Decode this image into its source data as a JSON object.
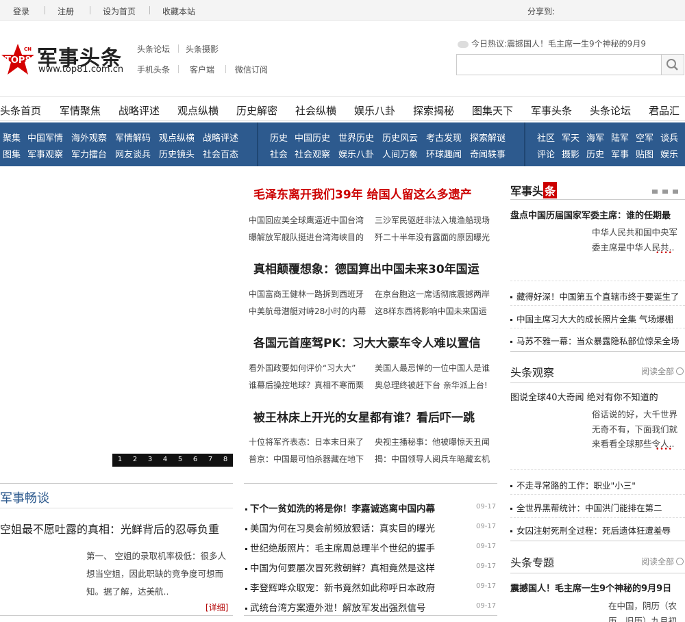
{
  "topbar": {
    "links": [
      "登录",
      "注册",
      "设为首页",
      "收藏本站"
    ],
    "share_label": "分享到:"
  },
  "header": {
    "logo_title": "军事头条",
    "logo_url": "www.top81.com.cn",
    "logo_badge": "TOP81",
    "logo_badge_cn": "CN",
    "links_row1": [
      "头条论坛",
      "头条摄影"
    ],
    "links_row2": [
      "手机头条",
      "客户端",
      "微信订阅"
    ],
    "hot_label": "今日热议:",
    "hot_text": "震撼国人！毛主席一生9个神秘的9月9",
    "search_placeholder": ""
  },
  "mainnav": [
    "头条首页",
    "军情聚焦",
    "战略评述",
    "观点纵横",
    "历史解密",
    "社会纵横",
    "娱乐八卦",
    "探索揭秘",
    "图集天下",
    "军事头条",
    "头条论坛",
    "君品汇"
  ],
  "subnav": {
    "block1_row1": [
      "聚集",
      "中国军情",
      "海外观察",
      "军情解码",
      "观点纵横",
      "战略评述"
    ],
    "block1_row2": [
      "图集",
      "军事观察",
      "军力擂台",
      "网友谈兵",
      "历史镜头",
      "社会百态"
    ],
    "block2_row1": [
      "历史",
      "中国历史",
      "世界历史",
      "历史风云",
      "考古发现",
      "探索解谜"
    ],
    "block2_row2": [
      "社会",
      "社会观察",
      "娱乐八卦",
      "人间万象",
      "环球趣闻",
      "奇闻轶事"
    ],
    "block3_row1": [
      "社区",
      "军天",
      "海军",
      "陆军",
      "空军",
      "谈兵"
    ],
    "block3_row2": [
      "评论",
      "摄影",
      "历史",
      "军事",
      "贴图",
      "娱乐"
    ]
  },
  "slider": {
    "pages": [
      "1",
      "2",
      "3",
      "4",
      "5",
      "6",
      "7",
      "8"
    ]
  },
  "left": {
    "section_title": "军事畅谈",
    "headline": "空姐最不愿吐露的真相：光鲜背后的忍辱负重",
    "body": "第一、 空姐的录取机率极低：很多人想当空姐，因此职缺的竞争度可想而知。据了解，达美航..",
    "more": "[详细]"
  },
  "center": {
    "groups": [
      {
        "headline": "毛泽东离开我们39年 给国人留这么多遗产",
        "red": true,
        "links": [
          "中国回应美全球鹰逼近中国台湾",
          "三沙军民驱赶非法入境渔船现场",
          "曝解放军舰队挺进台湾海峡目的",
          "歼二十半年没有露面的原因曝光"
        ]
      },
      {
        "headline": "真相颠覆想象：德国算出中国未来30年国运",
        "red": false,
        "links": [
          "中国富商王健林一路拆到西班牙",
          "在京台胞这一席话彻底震撼两岸",
          "中美航母潜艇对峙28小时的内幕",
          "这8样东西将影响中国未来国运"
        ]
      },
      {
        "headline": "各国元首座驾PK：习大大豪车令人难以置信",
        "red": false,
        "links": [
          "看外国政要如何评价“习大大”",
          "美国人最忌惮的一位中国人是谁",
          "谁幕后操控地球？真相不寒而栗",
          "奥总理终被赶下台 亲华派上台!"
        ]
      },
      {
        "headline": "被王林床上开光的女星都有谁？看后吓一跳",
        "red": false,
        "links": [
          "十位将军齐表态：日本末日来了",
          "央视主播秘事：他被曝惊天丑闻",
          "普京：中国最可怕杀器藏在地下",
          "揭：中国领导人阅兵车暗藏玄机"
        ]
      }
    ],
    "list": [
      {
        "title": "下个一贫如洗的将是你！李嘉诚逃离中国内幕",
        "date": "09-17",
        "bold": true
      },
      {
        "title": "美国为何在习奥会前频放狠话：真实目的曝光",
        "date": "09-17",
        "bold": false
      },
      {
        "title": "世纪绝版照片：毛主席周总理半个世纪的握手",
        "date": "09-17",
        "bold": false
      },
      {
        "title": "中国为何要屡次冒死救朝鲜？真相竟然是这样",
        "date": "09-17",
        "bold": false
      },
      {
        "title": "李登辉哗众取宠：新书竟然如此称呼日本政府",
        "date": "09-17",
        "bold": false
      },
      {
        "title": "武统台湾方案遭外泄！解放军发出强烈信号",
        "date": "09-17",
        "bold": false
      }
    ]
  },
  "right": {
    "section1_title_a": "军事头",
    "section1_title_b": "条",
    "s1_feature": "盘点中国历届国家军委主席：谁的任期最",
    "s1_desc": "中华人民共和国中央军委主席是中华人民共..",
    "s1_items": [
      "藏得好深！中国第五个直辖市终于要诞生了",
      "中国主席习大大的成长照片全集 气场爆棚",
      "马苏不雅一幕：当众暴露隐私部位惊呆全场"
    ],
    "section2_title": "头条观察",
    "section2_more": "阅读全部",
    "s2_feature": "图说全球40大奇闻 绝对有你不知道的",
    "s2_desc": "俗话说的好，大千世界无奇不有，下面我们就来看看全球那些令人..",
    "s2_items": [
      "不走寻常路的工作：职业\"小三\"",
      "全世界黑帮统计：中国洪门能排在第二",
      "女囚注射死刑全过程：死后遗体狂遭羞辱"
    ],
    "section3_title": "头条专题",
    "section3_more": "阅读全部",
    "s3_feature": "震撼国人！毛主席一生9个神秘的9月9日",
    "s3_desc": "在中国，阴历（农历、旧历）九月初九"
  },
  "colors": {
    "brand_red": "#cc0000",
    "nav_blue": "#2d5a8e"
  }
}
